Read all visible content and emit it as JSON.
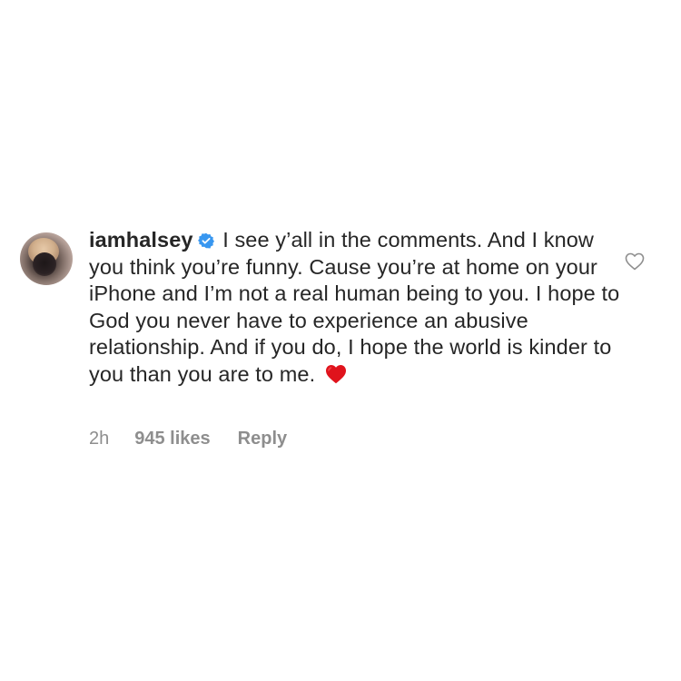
{
  "comment": {
    "username": "iamhalsey",
    "verified_icon": "verified-badge-icon",
    "text": "I see y’all in the comments. And I know you think you’re funny. Cause you’re at home on your iPhone and I’m not a real human being to you. I hope to God you never have to experience an abusive relationship. And if you do, I hope the world is kinder to you than you are to me.",
    "emoji_icon": "red-heart-emoji-icon",
    "time": "2h",
    "likes": "945 likes",
    "reply_label": "Reply",
    "like_icon": "heart-outline-icon"
  },
  "colors": {
    "verified_blue": "#3897f0",
    "emoji_red": "#e0131c",
    "meta_gray": "#8e8e8e",
    "text": "#262626"
  }
}
